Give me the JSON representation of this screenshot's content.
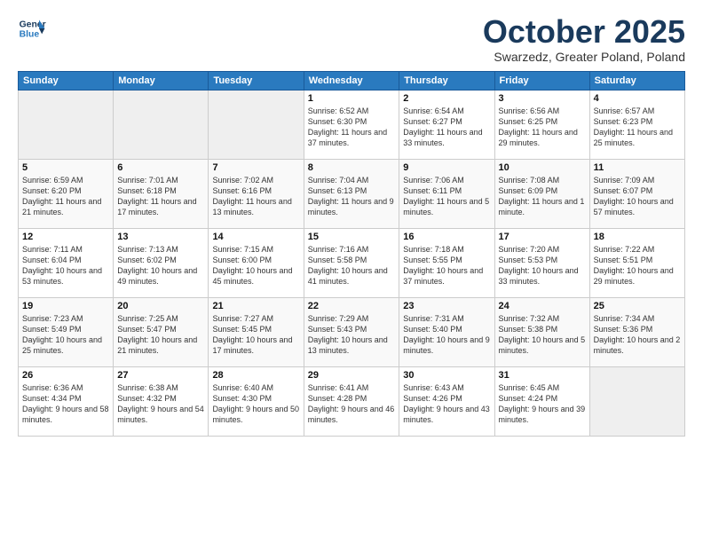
{
  "header": {
    "logo_line1": "General",
    "logo_line2": "Blue",
    "month": "October 2025",
    "location": "Swarzedz, Greater Poland, Poland"
  },
  "days_of_week": [
    "Sunday",
    "Monday",
    "Tuesday",
    "Wednesday",
    "Thursday",
    "Friday",
    "Saturday"
  ],
  "weeks": [
    [
      {
        "day": "",
        "info": ""
      },
      {
        "day": "",
        "info": ""
      },
      {
        "day": "",
        "info": ""
      },
      {
        "day": "1",
        "info": "Sunrise: 6:52 AM\nSunset: 6:30 PM\nDaylight: 11 hours\nand 37 minutes."
      },
      {
        "day": "2",
        "info": "Sunrise: 6:54 AM\nSunset: 6:27 PM\nDaylight: 11 hours\nand 33 minutes."
      },
      {
        "day": "3",
        "info": "Sunrise: 6:56 AM\nSunset: 6:25 PM\nDaylight: 11 hours\nand 29 minutes."
      },
      {
        "day": "4",
        "info": "Sunrise: 6:57 AM\nSunset: 6:23 PM\nDaylight: 11 hours\nand 25 minutes."
      }
    ],
    [
      {
        "day": "5",
        "info": "Sunrise: 6:59 AM\nSunset: 6:20 PM\nDaylight: 11 hours\nand 21 minutes."
      },
      {
        "day": "6",
        "info": "Sunrise: 7:01 AM\nSunset: 6:18 PM\nDaylight: 11 hours\nand 17 minutes."
      },
      {
        "day": "7",
        "info": "Sunrise: 7:02 AM\nSunset: 6:16 PM\nDaylight: 11 hours\nand 13 minutes."
      },
      {
        "day": "8",
        "info": "Sunrise: 7:04 AM\nSunset: 6:13 PM\nDaylight: 11 hours\nand 9 minutes."
      },
      {
        "day": "9",
        "info": "Sunrise: 7:06 AM\nSunset: 6:11 PM\nDaylight: 11 hours\nand 5 minutes."
      },
      {
        "day": "10",
        "info": "Sunrise: 7:08 AM\nSunset: 6:09 PM\nDaylight: 11 hours\nand 1 minute."
      },
      {
        "day": "11",
        "info": "Sunrise: 7:09 AM\nSunset: 6:07 PM\nDaylight: 10 hours\nand 57 minutes."
      }
    ],
    [
      {
        "day": "12",
        "info": "Sunrise: 7:11 AM\nSunset: 6:04 PM\nDaylight: 10 hours\nand 53 minutes."
      },
      {
        "day": "13",
        "info": "Sunrise: 7:13 AM\nSunset: 6:02 PM\nDaylight: 10 hours\nand 49 minutes."
      },
      {
        "day": "14",
        "info": "Sunrise: 7:15 AM\nSunset: 6:00 PM\nDaylight: 10 hours\nand 45 minutes."
      },
      {
        "day": "15",
        "info": "Sunrise: 7:16 AM\nSunset: 5:58 PM\nDaylight: 10 hours\nand 41 minutes."
      },
      {
        "day": "16",
        "info": "Sunrise: 7:18 AM\nSunset: 5:55 PM\nDaylight: 10 hours\nand 37 minutes."
      },
      {
        "day": "17",
        "info": "Sunrise: 7:20 AM\nSunset: 5:53 PM\nDaylight: 10 hours\nand 33 minutes."
      },
      {
        "day": "18",
        "info": "Sunrise: 7:22 AM\nSunset: 5:51 PM\nDaylight: 10 hours\nand 29 minutes."
      }
    ],
    [
      {
        "day": "19",
        "info": "Sunrise: 7:23 AM\nSunset: 5:49 PM\nDaylight: 10 hours\nand 25 minutes."
      },
      {
        "day": "20",
        "info": "Sunrise: 7:25 AM\nSunset: 5:47 PM\nDaylight: 10 hours\nand 21 minutes."
      },
      {
        "day": "21",
        "info": "Sunrise: 7:27 AM\nSunset: 5:45 PM\nDaylight: 10 hours\nand 17 minutes."
      },
      {
        "day": "22",
        "info": "Sunrise: 7:29 AM\nSunset: 5:43 PM\nDaylight: 10 hours\nand 13 minutes."
      },
      {
        "day": "23",
        "info": "Sunrise: 7:31 AM\nSunset: 5:40 PM\nDaylight: 10 hours\nand 9 minutes."
      },
      {
        "day": "24",
        "info": "Sunrise: 7:32 AM\nSunset: 5:38 PM\nDaylight: 10 hours\nand 5 minutes."
      },
      {
        "day": "25",
        "info": "Sunrise: 7:34 AM\nSunset: 5:36 PM\nDaylight: 10 hours\nand 2 minutes."
      }
    ],
    [
      {
        "day": "26",
        "info": "Sunrise: 6:36 AM\nSunset: 4:34 PM\nDaylight: 9 hours\nand 58 minutes."
      },
      {
        "day": "27",
        "info": "Sunrise: 6:38 AM\nSunset: 4:32 PM\nDaylight: 9 hours\nand 54 minutes."
      },
      {
        "day": "28",
        "info": "Sunrise: 6:40 AM\nSunset: 4:30 PM\nDaylight: 9 hours\nand 50 minutes."
      },
      {
        "day": "29",
        "info": "Sunrise: 6:41 AM\nSunset: 4:28 PM\nDaylight: 9 hours\nand 46 minutes."
      },
      {
        "day": "30",
        "info": "Sunrise: 6:43 AM\nSunset: 4:26 PM\nDaylight: 9 hours\nand 43 minutes."
      },
      {
        "day": "31",
        "info": "Sunrise: 6:45 AM\nSunset: 4:24 PM\nDaylight: 9 hours\nand 39 minutes."
      },
      {
        "day": "",
        "info": ""
      }
    ]
  ]
}
